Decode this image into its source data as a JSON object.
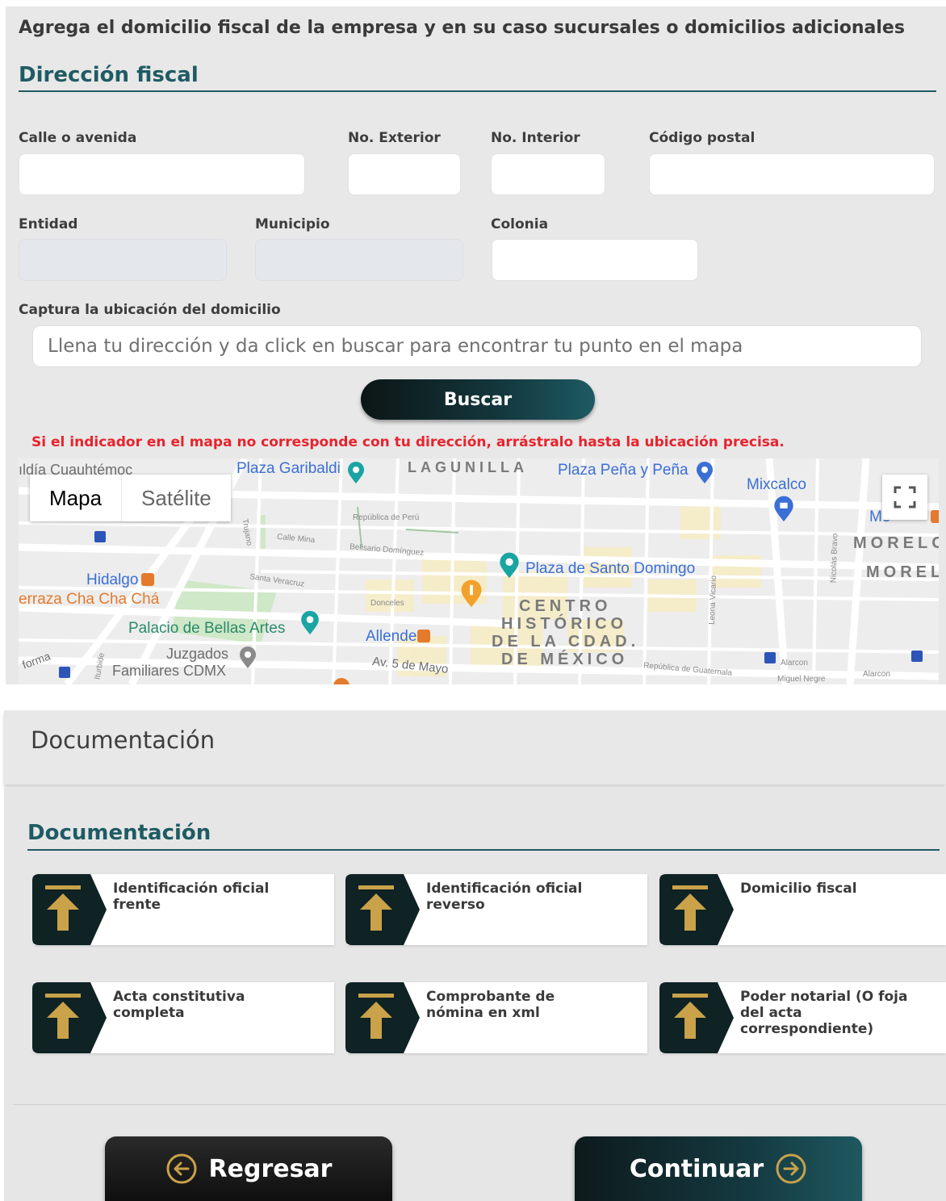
{
  "address": {
    "intro": "Agrega el domicilio fiscal de la empresa y en su caso sucursales o domicilios adicionales",
    "section_title": "Dirección fiscal",
    "fields": {
      "street": {
        "label": "Calle o avenida",
        "value": ""
      },
      "ext_number": {
        "label": "No. Exterior",
        "value": ""
      },
      "int_number": {
        "label": "No. Interior",
        "value": ""
      },
      "postal_code": {
        "label": "Código postal",
        "value": ""
      },
      "state": {
        "label": "Entidad",
        "value": ""
      },
      "municipality": {
        "label": "Municipio",
        "value": ""
      },
      "neighborhood": {
        "label": "Colonia",
        "value": ""
      }
    },
    "location": {
      "label": "Captura la ubicación del domicilio",
      "placeholder": "Llena tu dirección y da click en buscar para encontrar tu punto en el mapa",
      "search_button": "Buscar",
      "warning": "Si el indicador en el mapa no corresponde con tu dirección, arrástralo hasta la ubicación precisa."
    }
  },
  "map": {
    "type_control": {
      "map": "Mapa",
      "satellite": "Satélite",
      "selected": "Mapa"
    },
    "fullscreen_icon": "fullscreen-icon",
    "labels": {
      "cuauhtemoc": "ıldía Cuauhtémoc",
      "plaza_garibaldi": "Plaza Garibaldi",
      "lagunilla": "LAGUNILLA",
      "plaza_pena": "Plaza Peña y Peña",
      "mixcalco": "Mixcalco",
      "mo": "Mo",
      "morelos_1": "MORELO",
      "morelos_2": "MOREL",
      "hidalgo": "Hidalgo",
      "cha_cha": "erraza Cha Cha Chá",
      "bellas_artes": "Palacio de Bellas Artes",
      "juzgados_1": "Juzgados",
      "juzgados_2": "Familiares CDMX",
      "forma": "forma",
      "allende": "Allende",
      "santo_domingo": "Plaza de Santo Domingo",
      "centro_1": "CENTRO",
      "centro_2": "HISTÓRICO",
      "centro_3": "DE LA CDAD.",
      "centro_4": "DE MÉXICO",
      "cinco_mayo": "Av. 5 de Mayo",
      "republica_peru": "República de Perú",
      "calle_mina": "Calle Mina",
      "belisario": "Belisario Domínguez",
      "santa_veracruz": "Santa Veracruz",
      "donceles": "Donceles",
      "trujano": "Trujano",
      "leona_vicario": "Leona Vicario",
      "nicolas_bravo": "Nicolás Bravo",
      "alarcon_1": "Alarcon",
      "alarcon_2": "Alarcon",
      "rep_guatemala": "República de Guatemala",
      "miguel": "Miguel Negre",
      "burbide": "Iturbide"
    },
    "colors": {
      "poi_blue": "#3b6fd6",
      "poi_orange": "#e37a2c",
      "poi_green": "#2a8a6b",
      "poi_teal": "#1aa5a3"
    }
  },
  "documentation": {
    "header_title": "Documentación",
    "section_title": "Documentación",
    "upload_icon": "upload-arrow-icon",
    "items": [
      {
        "label": "Identificación oficial frente"
      },
      {
        "label": "Identificación oficial reverso"
      },
      {
        "label": "Domicilio fiscal"
      },
      {
        "label": "Acta constitutiva completa"
      },
      {
        "label": "Comprobante de nómina en xml"
      },
      {
        "label": "Poder notarial (O foja del acta correspondiente)"
      }
    ]
  },
  "footer": {
    "back_label": "Regresar",
    "next_label": "Continuar"
  },
  "colors": {
    "accent_teal": "#1f5b63",
    "accent_gold": "#c9a24a",
    "warning_red": "#e8232d",
    "dark": "#0f1a1c"
  }
}
